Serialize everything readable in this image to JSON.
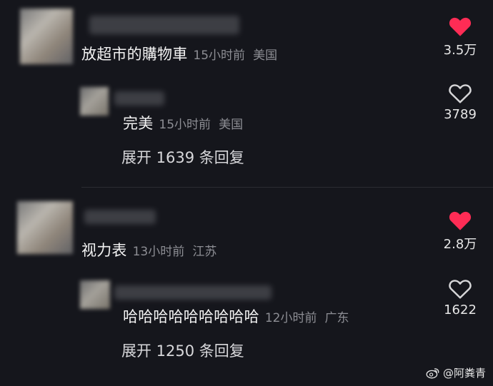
{
  "comments": [
    {
      "text": "放超市的購物車",
      "time": "15小时前",
      "location": "美国",
      "likes": "3.5万",
      "liked": true,
      "reply": {
        "text": "完美",
        "time": "15小时前",
        "location": "美国",
        "likes": "3789",
        "liked": false
      },
      "expand_label": "展开 1639 条回复"
    },
    {
      "text": "视力表",
      "time": "13小时前",
      "location": "江苏",
      "likes": "2.8万",
      "liked": true,
      "reply": {
        "text": "哈哈哈哈哈哈哈哈哈",
        "time": "12小时前",
        "location": "广东",
        "likes": "1622",
        "liked": false
      },
      "expand_label": "展开 1250 条回复"
    }
  ],
  "watermark": {
    "icon": "weibo-icon",
    "text": "@阿粪青"
  },
  "colors": {
    "background": "#15161c",
    "liked_heart": "#fe2c55",
    "meta_text": "#8d8e94"
  }
}
